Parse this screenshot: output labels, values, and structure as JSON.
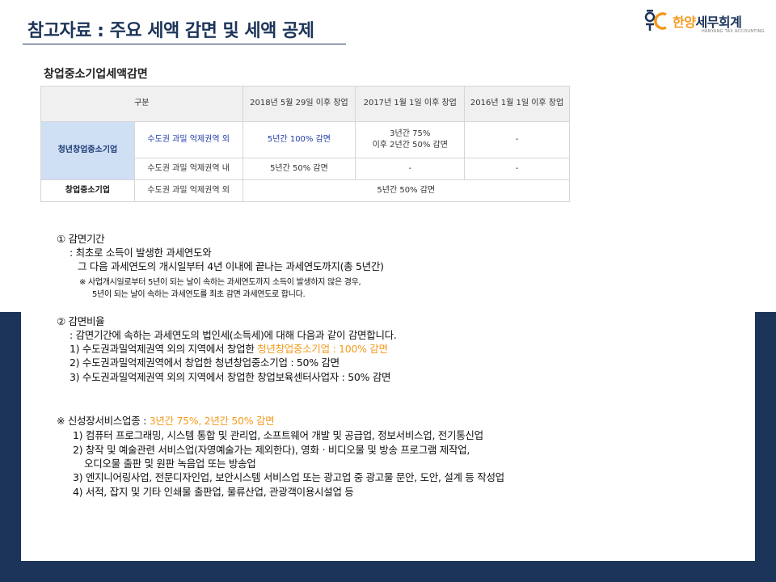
{
  "header": {
    "title": "참고자료 : 주요 세액 감면 및 세액 공제",
    "logo_part1": "한양",
    "logo_part2": "세무회계",
    "logo_sub": "HANYANG TAX ACCOUNTING"
  },
  "section_heading": "창업중소기업세액감면",
  "table": {
    "headers": [
      "구분",
      "2018년 5월 29일 이후 창업",
      "2017년 1월 1일 이후 창업",
      "2016년 1월 1일 이후 창업"
    ],
    "rows": [
      {
        "category": "청년창업중소기업",
        "region": "수도권 과밀 억제권역 외",
        "c2018": "5년간 100% 감면",
        "c2017_l1": "3년간 75%",
        "c2017_l2": "이후 2년간 50% 감면",
        "c2016": "-"
      },
      {
        "region": "수도권 과밀 억제권역 내",
        "c2018": "5년간 50% 감면",
        "c2017": "-",
        "c2016": "-"
      },
      {
        "category": "창업중소기업",
        "region": "수도권 과밀 억제권역 외",
        "merged": "5년간 50% 감면"
      }
    ]
  },
  "period": {
    "heading": "① 감면기간",
    "line1": ": 최초로 소득이 발생한 과세연도와",
    "line2": "그 다음 과세연도의 개시일부터 4년 이내에 끝나는 과세연도까지(총 5년간)",
    "note1": "※ 사업개시일로부터 5년이 되는 날이 속하는 과세연도까지 소득이 발생하지 않은 경우,",
    "note2": "5년이 되는 날이 속하는 과세연도를 최초 감면 과세연도로 합니다."
  },
  "ratio": {
    "heading": "② 감면비율",
    "intro": ": 감면기간에 속하는 과세연도의 법인세(소득세)에 대해 다음과 같이 감면합니다.",
    "item1_prefix": "1) 수도권과밀억제권역 외의 지역에서 창업한 ",
    "item1_highlight": "청년창업중소기업 : 100% 감면",
    "item2": "2) 수도권과밀억제권역에서 창업한 청년창업중소기업 : 50% 감면",
    "item3": "3) 수도권과밀억제권역 외의 지역에서 창업한 창업보육센터사업자 : 50% 감면"
  },
  "growth": {
    "heading_prefix": "※ 신성장서비스업종 : ",
    "heading_highlight": "3년간 75%, 2년간 50% 감면",
    "item1": "1) 컴퓨터 프로그래밍, 시스템 통합 및 관리업, 소프트웨어 개발 및 공급업, 정보서비스업, 전기통신업",
    "item2a": "2) 창작 및 예술관련 서비스업(자영예술가는 제외한다), 영화ㆍ비디오물 및 방송 프로그램 제작업,",
    "item2b": "오디오물 출판 및 원판 녹음업 또는 방송업",
    "item3": "3) 엔지니어링사업, 전문디자인업, 보안시스템 서비스업 또는 광고업 중 광고물 문안, 도안, 설계 등 작성업",
    "item4": "4) 서적, 잡지 및 기타 인쇄물 출판업, 물류산업, 관광객이용시설업 등"
  },
  "colors": {
    "navy": "#1c3459",
    "orange": "#f39a1d",
    "highlight_cell": "#cfe0f5"
  }
}
